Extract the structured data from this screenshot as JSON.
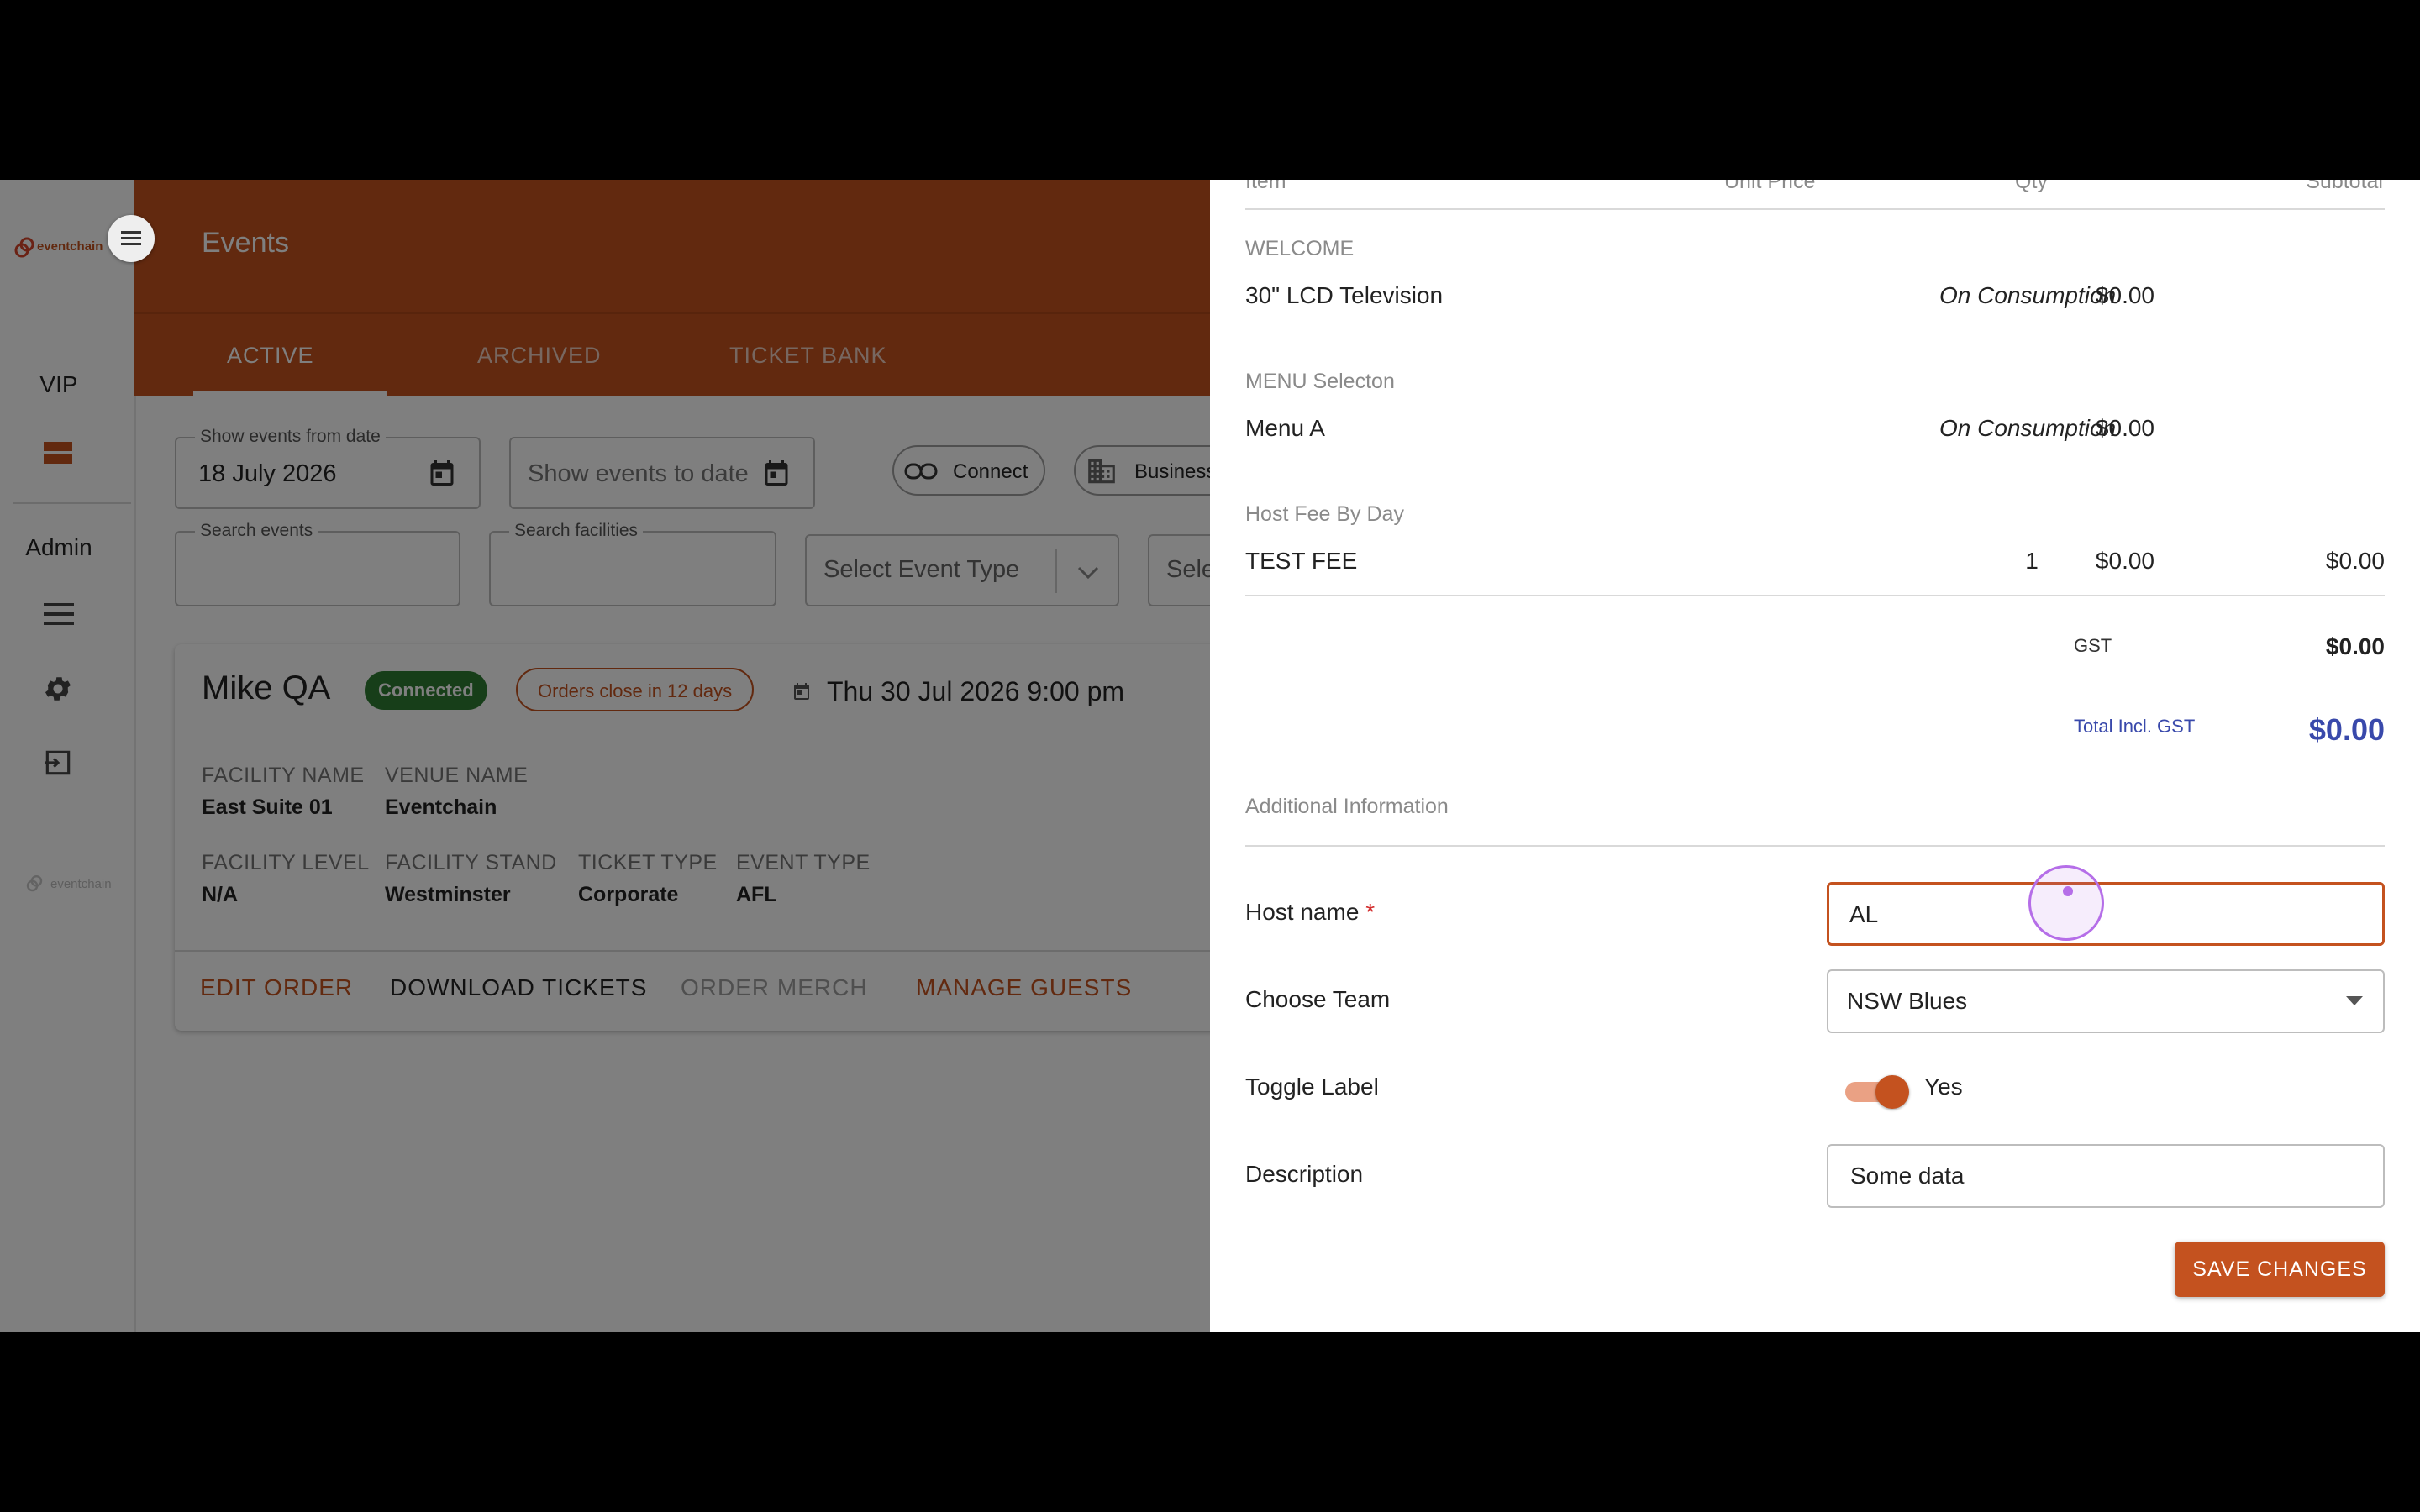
{
  "rail": {
    "logo_text": "eventchain",
    "vip_label": "VIP",
    "admin_label": "Admin",
    "footer_logo_text": "eventchain"
  },
  "header": {
    "title": "Events"
  },
  "tabs": [
    {
      "label": "ACTIVE"
    },
    {
      "label": "ARCHIVED"
    },
    {
      "label": "TICKET BANK"
    }
  ],
  "filters": {
    "from_date_label": "Show events from date",
    "from_date_value": "18 July 2026",
    "to_date_placeholder": "Show events to date",
    "connect_chip": "Connect",
    "business_chip": "Business",
    "search_events_label": "Search events",
    "search_facilities_label": "Search facilities",
    "event_type_placeholder": "Select Event Type",
    "next_select_placeholder": "Sele"
  },
  "event": {
    "title": "Mike QA",
    "status_badge": "Connected",
    "orders_badge": "Orders close in 12 days",
    "datetime": "Thu 30 Jul 2026 9:00 pm",
    "facility_name_label": "FACILITY NAME",
    "facility_name": "East Suite 01",
    "venue_name_label": "VENUE NAME",
    "venue_name": "Eventchain",
    "facility_level_label": "FACILITY LEVEL",
    "facility_level": "N/A",
    "facility_stand_label": "FACILITY STAND",
    "facility_stand": "Westminster",
    "ticket_type_label": "TICKET TYPE",
    "ticket_type": "Corporate",
    "event_type_label": "EVENT TYPE",
    "event_type": "AFL",
    "actions": {
      "edit": "EDIT ORDER",
      "download": "DOWNLOAD TICKETS",
      "merch": "ORDER MERCH",
      "guests": "MANAGE GUESTS"
    }
  },
  "panel": {
    "columns": [
      "Item",
      "Unit Price",
      "Qty",
      "Subtotal"
    ],
    "sections": [
      {
        "heading": "WELCOME",
        "item": "30\" LCD Television",
        "price": "$0.00",
        "qty": "On Consumption",
        "subtotal": ""
      },
      {
        "heading": "MENU Selecton",
        "item": "Menu A",
        "price": "$0.00",
        "qty": "On Consumption",
        "subtotal": ""
      },
      {
        "heading": "Host Fee By Day",
        "item": "TEST FEE",
        "price": "$0.00",
        "qty": "1",
        "subtotal": "$0.00"
      }
    ],
    "gst_label": "GST",
    "gst_value": "$0.00",
    "total_label": "Total Incl. GST",
    "total_value": "$0.00",
    "additional_heading": "Additional Information",
    "host_name_label": "Host name",
    "host_name_required": "*",
    "host_name_value": "AL",
    "team_label": "Choose Team",
    "team_value": "NSW Blues",
    "toggle_label": "Toggle Label",
    "toggle_state": "Yes",
    "description_label": "Description",
    "description_value": "Some data",
    "save_button": "SAVE CHANGES"
  },
  "colors": {
    "brand": "#c4521f",
    "connected": "#2e7d32",
    "total": "#3949ab",
    "cursor": "#b56ee8"
  }
}
